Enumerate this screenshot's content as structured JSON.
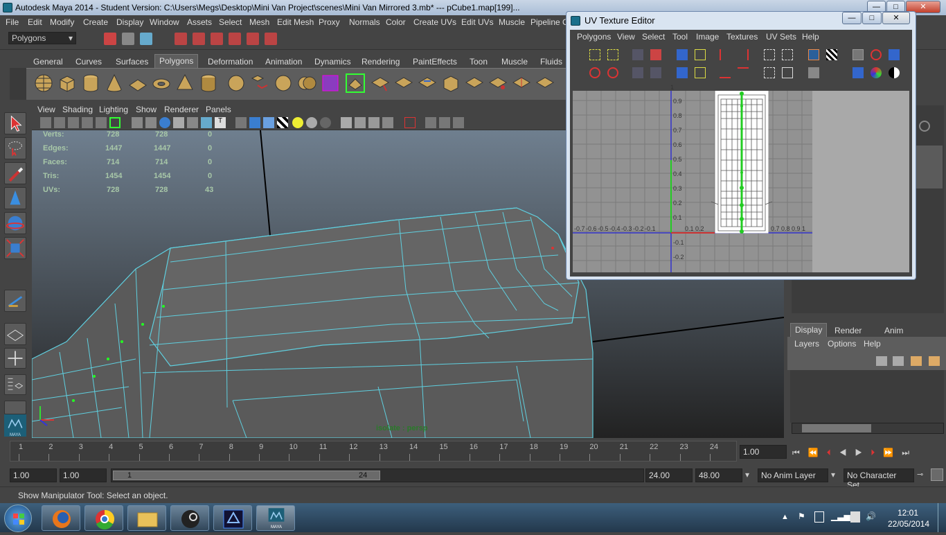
{
  "window": {
    "title": "Autodesk Maya 2014 - Student Version: C:\\Users\\Megs\\Desktop\\Mini Van Project\\scenes\\Mini Van Mirrored 3.mb*   ---   pCube1.map[199]..."
  },
  "menubar": [
    "File",
    "Edit",
    "Modify",
    "Create",
    "Display",
    "Window",
    "Assets",
    "Select",
    "Mesh",
    "Edit Mesh",
    "Proxy",
    "Normals",
    "Color",
    "Create UVs",
    "Edit UVs",
    "Muscle",
    "Pipeline C"
  ],
  "status_line": {
    "mode": "Polygons"
  },
  "shelf_tabs": [
    "General",
    "Curves",
    "Surfaces",
    "Polygons",
    "Deformation",
    "Animation",
    "Dynamics",
    "Rendering",
    "PaintEffects",
    "Toon",
    "Muscle",
    "Fluids"
  ],
  "shelf_active_tab": "Polygons",
  "panel_menu": [
    "View",
    "Shading",
    "Lighting",
    "Show",
    "Renderer",
    "Panels"
  ],
  "hud": {
    "rows": [
      {
        "label": "Verts:",
        "v1": "728",
        "v2": "728",
        "v3": "0"
      },
      {
        "label": "Edges:",
        "v1": "1447",
        "v2": "1447",
        "v3": "0"
      },
      {
        "label": "Faces:",
        "v1": "714",
        "v2": "714",
        "v3": "0"
      },
      {
        "label": "Tris:",
        "v1": "1454",
        "v2": "1454",
        "v3": "0"
      },
      {
        "label": "UVs:",
        "v1": "728",
        "v2": "728",
        "v3": "43"
      }
    ],
    "camera_label": "isolate : persp"
  },
  "uv_editor": {
    "title": "UV Texture Editor",
    "menu": [
      "Polygons",
      "View",
      "Select",
      "Tool",
      "Image",
      "Textures",
      "UV Sets",
      "Help"
    ],
    "axis_top": "1",
    "y_ticks": [
      "0.9",
      "0.8",
      "0.7",
      "0.6",
      "0.5",
      "0.4",
      "0.3",
      "0.2",
      "0.1",
      "-0.1",
      "-0.2"
    ],
    "x_ticks_neg": "-0.7 -0.6 -0.5 -0.4 -0.3 -0.2 -0.1",
    "x_ticks_pos_a": "0.1  0.2",
    "x_ticks_pos_b": "0.7  0.8  0.9  1"
  },
  "layer_editor": {
    "tabs": [
      "Display",
      "Render",
      "Anim"
    ],
    "menu": [
      "Layers",
      "Options",
      "Help"
    ]
  },
  "timeline": {
    "ticks": [
      "1",
      "2",
      "3",
      "4",
      "5",
      "6",
      "7",
      "8",
      "9",
      "10",
      "11",
      "12",
      "13",
      "14",
      "15",
      "16",
      "17",
      "18",
      "19",
      "20",
      "21",
      "22",
      "23",
      "24"
    ],
    "current_frame": "1.00"
  },
  "range": {
    "start": "1.00",
    "playback_start": "1.00",
    "slider_start": "1",
    "slider_end": "24",
    "playback_end": "24.00",
    "end": "48.00",
    "anim_layer": "No Anim Layer",
    "character_set": "No Character Set"
  },
  "help_line": "Show Manipulator Tool: Select an object.",
  "taskbar": {
    "time": "12:01",
    "date": "22/05/2014",
    "maya_label": "MAYA"
  },
  "colors": {
    "viewport_top": "#6f7f8f",
    "viewport_bottom": "#222",
    "wire": "#5fd0e0",
    "active_tab": "#5d5d5d"
  }
}
